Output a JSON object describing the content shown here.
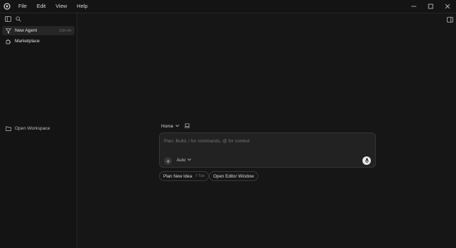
{
  "app": {
    "menu": [
      "File",
      "Edit",
      "View",
      "Help"
    ],
    "logo_icon": "cursor-logo-icon",
    "window_controls": [
      "minimize-icon",
      "maximize-icon",
      "close-icon"
    ]
  },
  "sidebar": {
    "toolbar_icons": [
      "sidebar-toggle-icon",
      "search-icon"
    ],
    "items": [
      {
        "label": "New Agent",
        "shortcut": "Ctrl+N",
        "icon": "filter-icon",
        "active": true
      },
      {
        "label": "Marketplace",
        "icon": "puzzle-icon"
      }
    ],
    "workspace_label": "Open Workspace"
  },
  "composer": {
    "location": "Home",
    "placeholder": "Plan, Build, / for commands, @ for context",
    "mode": "Auto"
  },
  "actions": {
    "plan_label": "Plan New Idea",
    "plan_shortcut": "⇧Tab",
    "editor_label": "Open Editor Window"
  },
  "colors": {
    "background": "#161616",
    "sidebar": "#141414",
    "composer": "#222222",
    "active_item": "#262626"
  }
}
